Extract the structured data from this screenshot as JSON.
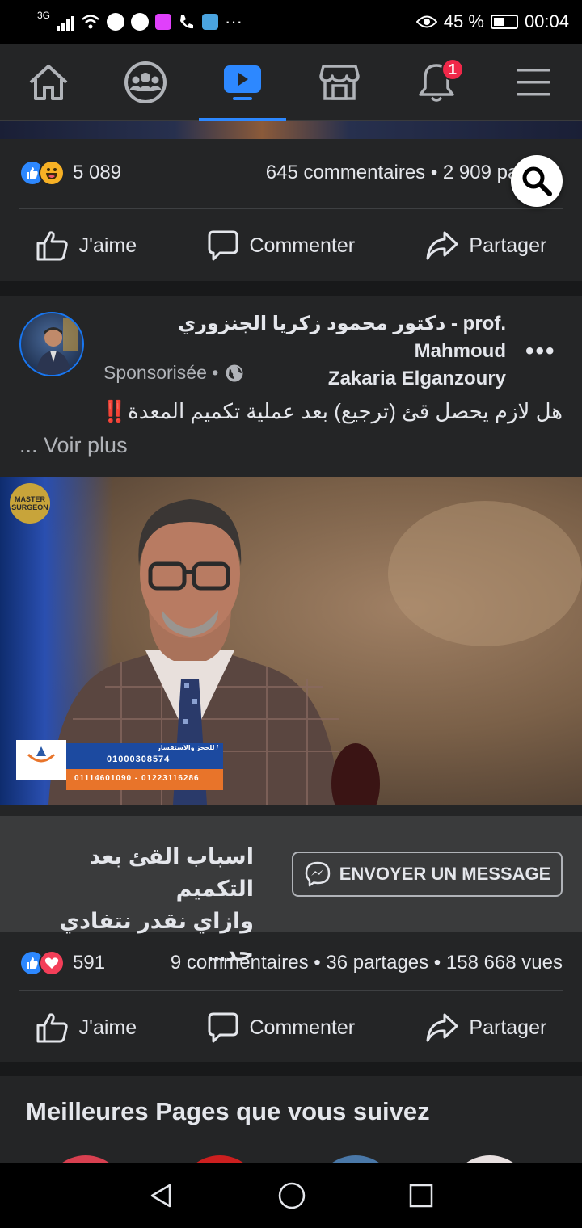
{
  "status_bar": {
    "signal": "3G",
    "battery": "45 %",
    "time": "00:04",
    "overflow": "···"
  },
  "nav": {
    "items": [
      "home",
      "groups",
      "watch",
      "marketplace",
      "notifications",
      "menu"
    ],
    "notification_count": "1",
    "accent": "#2d88ff"
  },
  "post1": {
    "reaction_count": "5 089",
    "comments_shares": "645 commentaires • 2 909 part",
    "like_label": "J'aime",
    "comment_label": "Commenter",
    "share_label": "Partager"
  },
  "post2": {
    "author_line1": "دكتور محمود زكريا الجنزوري - prof. Mahmoud",
    "author_line2": "Zakaria Elganzoury",
    "more": "•••",
    "sponsored": "Sponsorisée •",
    "text": "هل لازم يحصل قئ (ترجيع) بعد عملية تكميم المعدة‼️",
    "see_more": "... Voir plus",
    "ad": {
      "phone1": "01000308574",
      "phone2": "01114601090 - 01223116286",
      "booking_label": "للحجز والاستفسار /",
      "badge_text": "MASTER SURGEON"
    },
    "cta_title_line1": "اسباب القئ بعد التكميم",
    "cta_title_line2": "وازاي نقدر نتفادي حد...",
    "cta_button": "ENVOYER UN MESSAGE",
    "reaction_count": "591",
    "stats": "9 commentaires • 36 partages • 158 668 vues",
    "like_label": "J'aime",
    "comment_label": "Commenter",
    "share_label": "Partager"
  },
  "pages_section": {
    "title": "Meilleures Pages que vous suivez"
  }
}
